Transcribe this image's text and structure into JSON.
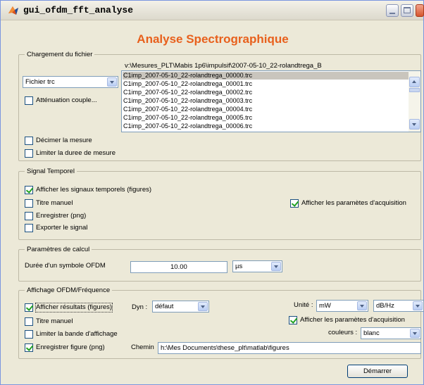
{
  "window": {
    "title": "gui_ofdm_fft_analyse",
    "heading": "Analyse Spectrographique"
  },
  "chargement": {
    "group_title": "Chargement du fichier",
    "path": "v:\\Mesures_PLT\\Mabis 1p6\\impulsif\\2007-05-10_22-rolandtrega_B",
    "file_type": {
      "selected": "Fichier trc"
    },
    "attenuation_label": "Atténuation couple...",
    "attenuation_checked": false,
    "files": [
      "C1imp_2007-05-10_22-rolandtrega_00000.trc",
      "C1imp_2007-05-10_22-rolandtrega_00001.trc",
      "C1imp_2007-05-10_22-rolandtrega_00002.trc",
      "C1imp_2007-05-10_22-rolandtrega_00003.trc",
      "C1imp_2007-05-10_22-rolandtrega_00004.trc",
      "C1imp_2007-05-10_22-rolandtrega_00005.trc",
      "C1imp_2007-05-10_22-rolandtrega_00006.trc"
    ],
    "selected_file_index": 0,
    "decimer_label": "Décimer la mesure",
    "decimer_checked": false,
    "limiter_duree_label": "Limiter la duree de mesure",
    "limiter_duree_checked": false
  },
  "signal": {
    "group_title": "Signal Temporel",
    "afficher_signaux_label": "Afficher les signaux temporels (figures)",
    "afficher_signaux_checked": true,
    "titre_manuel_label": "Titre manuel",
    "titre_manuel_checked": false,
    "enregistrer_label": "Enregistrer (png)",
    "enregistrer_checked": false,
    "exporter_label": "Exporter le signal",
    "exporter_checked": false,
    "afficher_params_label": "Afficher les paramètes d'acquisition",
    "afficher_params_checked": true
  },
  "calcul": {
    "group_title": "Paramètres de calcul",
    "duree_label": "Durée d'un symbole OFDM",
    "duree_value": "10.00",
    "unit_selected": "µs"
  },
  "affichage": {
    "group_title": "Affichage OFDM/Fréquence",
    "afficher_resultats_label": "Afficher résultats (figures)",
    "afficher_resultats_checked": true,
    "dyn_label": "Dyn :",
    "dyn_selected": "défaut",
    "unite_label": "Unité :",
    "unite_selected": "mW",
    "dbhz_selected": "dB/Hz",
    "titre_manuel_label": "Titre manuel",
    "titre_manuel_checked": false,
    "afficher_params_label": "Afficher les paramètes d'acquisition",
    "afficher_params_checked": true,
    "limiter_bande_label": "Limiter la bande d'affichage",
    "limiter_bande_checked": false,
    "couleurs_label": "couleurs :",
    "couleurs_selected": "blanc",
    "enregistrer_figure_label": "Enregistrer figure (png)",
    "enregistrer_figure_checked": true,
    "chemin_label": "Chemin",
    "chemin_value": "h:\\Mes Documents\\these_plt\\matlab\\figures"
  },
  "demarrer_label": "Démarrer",
  "colors": {
    "heading": "#e8601c",
    "window_bg": "#ece9d8",
    "check": "#21a121"
  }
}
